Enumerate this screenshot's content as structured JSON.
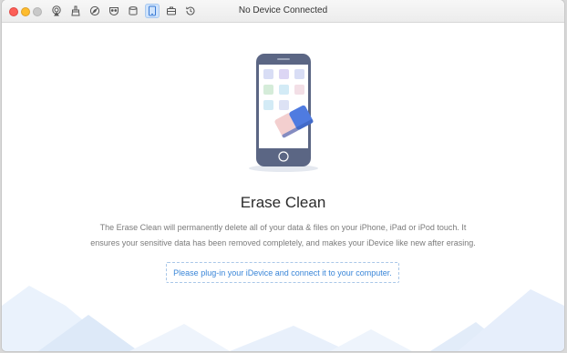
{
  "window": {
    "title": "No Device Connected"
  },
  "toolbar": {
    "icons": [
      "airplay-icon",
      "brush-icon",
      "compass-icon",
      "mask-icon",
      "trash-icon",
      "tablet-icon",
      "briefcase-icon",
      "history-icon"
    ],
    "active_index": 5
  },
  "main": {
    "heading": "Erase Clean",
    "description_line1": "The Erase Clean will permanently delete all of your data & files on your iPhone, iPad or iPod touch. It",
    "description_line2": "ensures your sensitive data has been removed completely, and makes your iDevice like new after erasing.",
    "plug_message": "Please plug-in your iDevice and connect it to your computer."
  },
  "colors": {
    "accent": "#3a86d8",
    "phone_body": "#5b6684",
    "eraser_blue": "#4f7be0",
    "eraser_pink": "#f3cfcf"
  }
}
